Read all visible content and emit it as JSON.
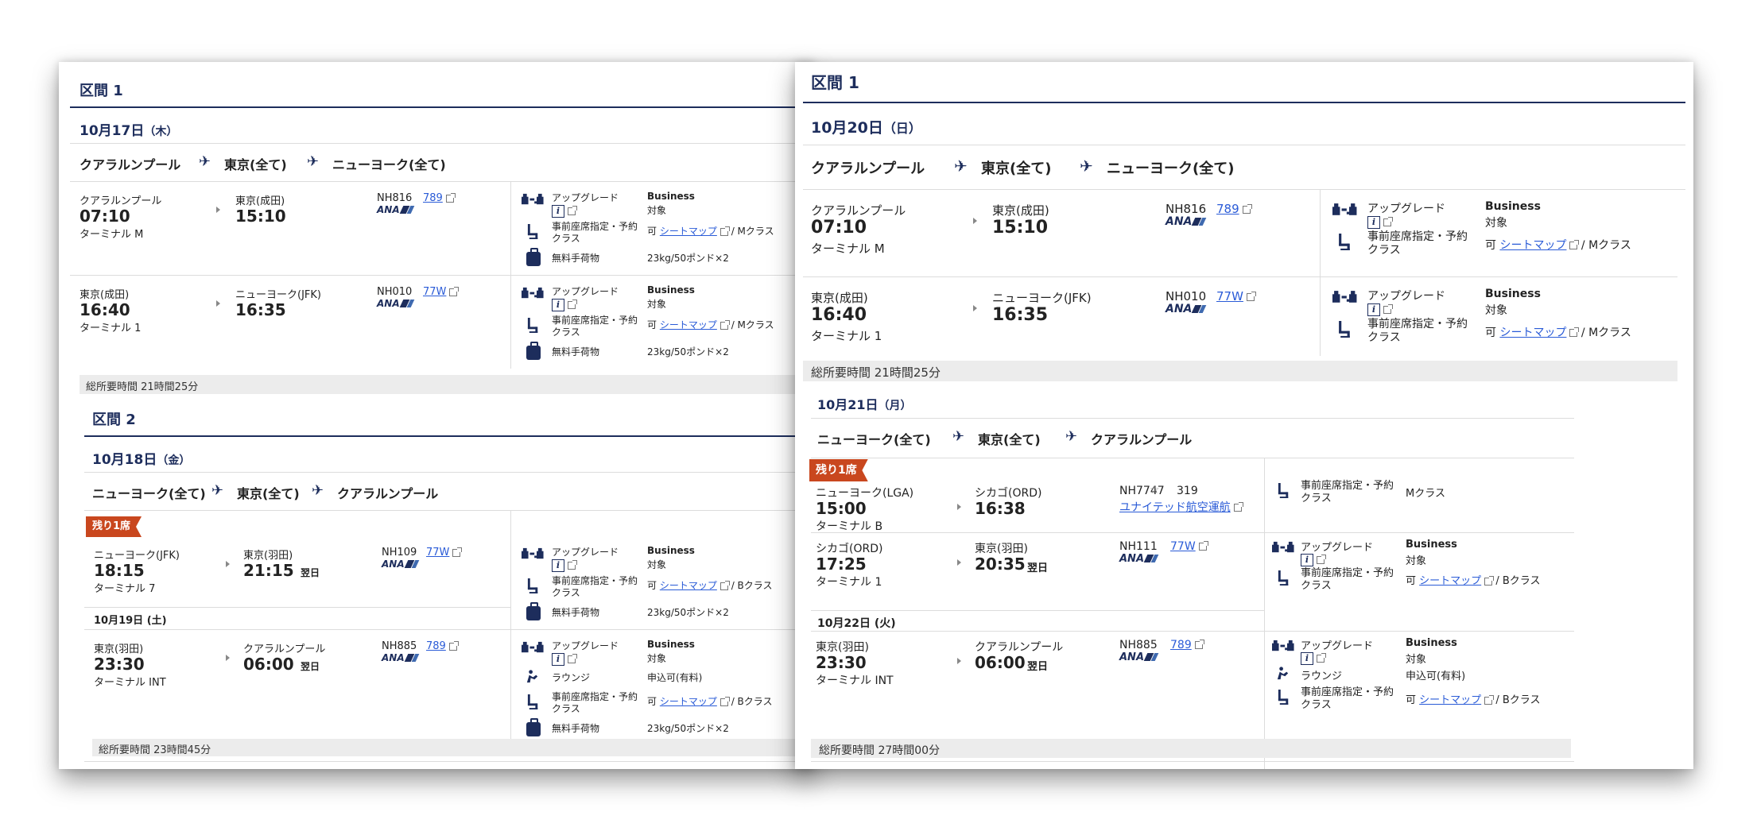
{
  "left": {
    "sec1": {
      "title": "区間 1",
      "date_md": "10月17日",
      "date_dow": "（木）",
      "route": [
        "クアラルンプール",
        "東京(全て)",
        "ニューヨーク(全て)"
      ],
      "flights": [
        {
          "dep_city": "クアラルンプール",
          "dep_time": "07:10",
          "dep_terminal": "ターミナル M",
          "arr_city": "東京(成田)",
          "arr_time": "15:10",
          "arr_suffix": "",
          "flight": "NH816",
          "aircraft": "789",
          "upgrade": "アップグレード",
          "upgrade_val": "Business",
          "upgrade_sub": "対象",
          "seat_label": "事前座席指定・予約クラス",
          "seat_avail": "可",
          "seat_map": "シートマップ",
          "seat_class": "/ Mクラス",
          "baggage_label": "無料手荷物",
          "baggage_val": "23kg/50ポンド×2"
        },
        {
          "dep_city": "東京(成田)",
          "dep_time": "16:40",
          "dep_terminal": "ターミナル 1",
          "arr_city": "ニューヨーク(JFK)",
          "arr_time": "16:35",
          "arr_suffix": "",
          "flight": "NH010",
          "aircraft": "77W",
          "upgrade": "アップグレード",
          "upgrade_val": "Business",
          "upgrade_sub": "対象",
          "seat_label": "事前座席指定・予約クラス",
          "seat_avail": "可",
          "seat_map": "シートマップ",
          "seat_class": "/ Mクラス",
          "baggage_label": "無料手荷物",
          "baggage_val": "23kg/50ポンド×2"
        }
      ],
      "total": "総所要時間 21時間25分"
    },
    "sec2": {
      "title": "区間 2",
      "date_md": "10月18日",
      "date_dow": "（金）",
      "route": [
        "ニューヨーク(全て)",
        "東京(全て)",
        "クアラルンプール"
      ],
      "badge": "残り1席",
      "flight1": {
        "dep_city": "ニューヨーク(JFK)",
        "dep_time": "18:15",
        "dep_terminal": "ターミナル 7",
        "arr_city": "東京(羽田)",
        "arr_time": "21:15",
        "arr_suffix": "翌日",
        "flight": "NH109",
        "aircraft": "77W",
        "upgrade": "アップグレード",
        "upgrade_val": "Business",
        "upgrade_sub": "対象",
        "seat_label": "事前座席指定・予約クラス",
        "seat_avail": "可",
        "seat_map": "シートマップ",
        "seat_class": "/ Bクラス",
        "baggage_label": "無料手荷物",
        "baggage_val": "23kg/50ポンド×2"
      },
      "date2": "10月19日 (土)",
      "flight2": {
        "dep_city": "東京(羽田)",
        "dep_time": "23:30",
        "dep_terminal": "ターミナル INT",
        "arr_city": "クアラルンプール",
        "arr_time": "06:00",
        "arr_suffix": "翌日",
        "flight": "NH885",
        "aircraft": "789",
        "upgrade": "アップグレード",
        "upgrade_val": "Business",
        "upgrade_sub": "対象",
        "lounge_label": "ラウンジ",
        "lounge_val": "申込可(有料)",
        "seat_label": "事前座席指定・予約クラス",
        "seat_avail": "可",
        "seat_map": "シートマップ",
        "seat_class": "/ Bクラス",
        "baggage_label": "無料手荷物",
        "baggage_val": "23kg/50ポンド×2"
      },
      "total": "総所要時間 23時間45分"
    }
  },
  "right": {
    "sec1": {
      "title": "区間 1",
      "date_md": "10月20日",
      "date_dow": "（日）",
      "route": [
        "クアラルンプール",
        "東京(全て)",
        "ニューヨーク(全て)"
      ],
      "flights": [
        {
          "dep_city": "クアラルンプール",
          "dep_time": "07:10",
          "dep_terminal": "ターミナル M",
          "arr_city": "東京(成田)",
          "arr_time": "15:10",
          "flight": "NH816",
          "aircraft": "789",
          "upgrade": "アップグレード",
          "upgrade_val": "Business",
          "upgrade_sub": "対象",
          "seat_label": "事前座席指定・予約クラス",
          "seat_avail": "可",
          "seat_map": "シートマップ",
          "seat_class": "/ Mクラス"
        },
        {
          "dep_city": "東京(成田)",
          "dep_time": "16:40",
          "dep_terminal": "ターミナル 1",
          "arr_city": "ニューヨーク(JFK)",
          "arr_time": "16:35",
          "flight": "NH010",
          "aircraft": "77W",
          "upgrade": "アップグレード",
          "upgrade_val": "Business",
          "upgrade_sub": "対象",
          "seat_label": "事前座席指定・予約クラス",
          "seat_avail": "可",
          "seat_map": "シートマップ",
          "seat_class": "/ Mクラス"
        }
      ],
      "total": "総所要時間 21時間25分"
    },
    "sec2": {
      "date_md": "10月21日",
      "date_dow": "（月）",
      "route": [
        "ニューヨーク(全て)",
        "東京(全て)",
        "クアラルンプール"
      ],
      "badge": "残り1席",
      "flight1": {
        "dep_city": "ニューヨーク(LGA)",
        "dep_time": "15:00",
        "dep_terminal": "ターミナル B",
        "arr_city": "シカゴ(ORD)",
        "arr_time": "16:38",
        "flight": "NH7747",
        "aircraft": "319",
        "operator": "ユナイテッド航空運航",
        "seat_label": "事前座席指定・予約クラス",
        "seat_class": "Mクラス"
      },
      "flight2": {
        "dep_city": "シカゴ(ORD)",
        "dep_time": "17:25",
        "dep_terminal": "ターミナル 1",
        "arr_city": "東京(羽田)",
        "arr_time": "20:35",
        "arr_suffix": "翌日",
        "flight": "NH111",
        "aircraft": "77W",
        "upgrade": "アップグレード",
        "upgrade_val": "Business",
        "upgrade_sub": "対象",
        "seat_label": "事前座席指定・予約クラス",
        "seat_avail": "可",
        "seat_map": "シートマップ",
        "seat_class": "/ Bクラス"
      },
      "date2": "10月22日 (火)",
      "flight3": {
        "dep_city": "東京(羽田)",
        "dep_time": "23:30",
        "dep_terminal": "ターミナル INT",
        "arr_city": "クアラルンプール",
        "arr_time": "06:00",
        "arr_suffix": "翌日",
        "flight": "NH885",
        "aircraft": "789",
        "upgrade": "アップグレード",
        "upgrade_val": "Business",
        "upgrade_sub": "対象",
        "lounge_label": "ラウンジ",
        "lounge_val": "申込可(有料)",
        "seat_label": "事前座席指定・予約クラス",
        "seat_avail": "可",
        "seat_map": "シートマップ",
        "seat_class": "/ Bクラス"
      },
      "total": "総所要時間 27時間00分"
    }
  },
  "common": {
    "airline_logo_text": "ANA",
    "plane_glyph": "✈",
    "star_glyph": "☆"
  }
}
